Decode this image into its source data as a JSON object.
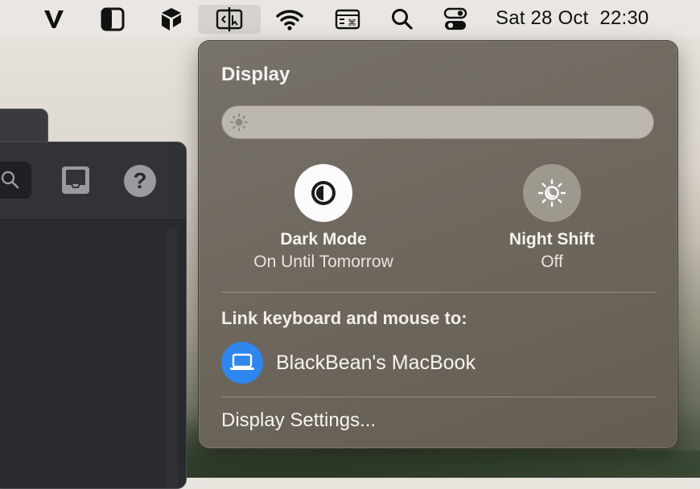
{
  "menubar": {
    "icons": [
      {
        "name": "vivaldi-icon"
      },
      {
        "name": "sidebar-toggle-icon"
      },
      {
        "name": "app-cube-icon"
      },
      {
        "name": "display-icon",
        "active": true
      },
      {
        "name": "wifi-icon"
      },
      {
        "name": "keyboard-shortcut-icon"
      },
      {
        "name": "spotlight-search-icon"
      },
      {
        "name": "control-center-icon"
      }
    ],
    "date": "Sat 28 Oct",
    "time": "22:30"
  },
  "display_panel": {
    "title": "Display",
    "brightness": {
      "level": 0.0,
      "icon": "sun-icon"
    },
    "dark_mode": {
      "title": "Dark Mode",
      "status": "On Until Tomorrow",
      "enabled": true
    },
    "night_shift": {
      "title": "Night Shift",
      "status": "Off",
      "enabled": false
    },
    "link_label": "Link keyboard and mouse to:",
    "device": {
      "name": "BlackBean's MacBook",
      "icon": "laptop-icon",
      "color": "#2f86ee"
    },
    "settings_label": "Display Settings..."
  }
}
